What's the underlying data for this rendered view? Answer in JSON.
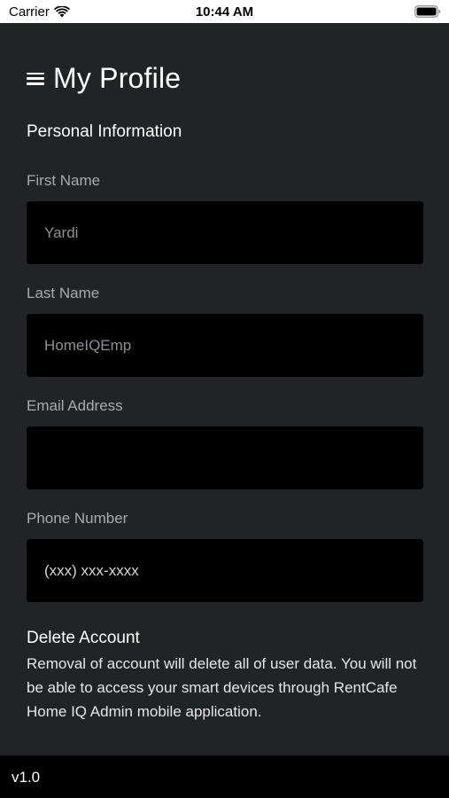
{
  "status_bar": {
    "carrier": "Carrier",
    "time": "10:44 AM",
    "wifi_icon": "wifi-icon",
    "battery_icon": "battery-icon"
  },
  "header": {
    "menu_icon": "hamburger-menu-icon",
    "title": "My Profile"
  },
  "personal_info": {
    "section_title": "Personal Information",
    "first_name": {
      "label": "First Name",
      "value": "Yardi"
    },
    "last_name": {
      "label": "Last Name",
      "value": "HomeIQEmp"
    },
    "email": {
      "label": "Email Address",
      "value": ""
    },
    "phone": {
      "label": "Phone Number",
      "placeholder": "(xxx) xxx-xxxx"
    }
  },
  "delete_account": {
    "section_title": "Delete Account",
    "description": "Removal of account will delete all of user data. You will not be able to access your smart devices through RentCafe Home IQ Admin mobile application."
  },
  "footer": {
    "version": "v1.0"
  },
  "colors": {
    "background": "#222325",
    "input_background": "#000000",
    "label": "#a9aaad",
    "footer_background": "#000000"
  }
}
